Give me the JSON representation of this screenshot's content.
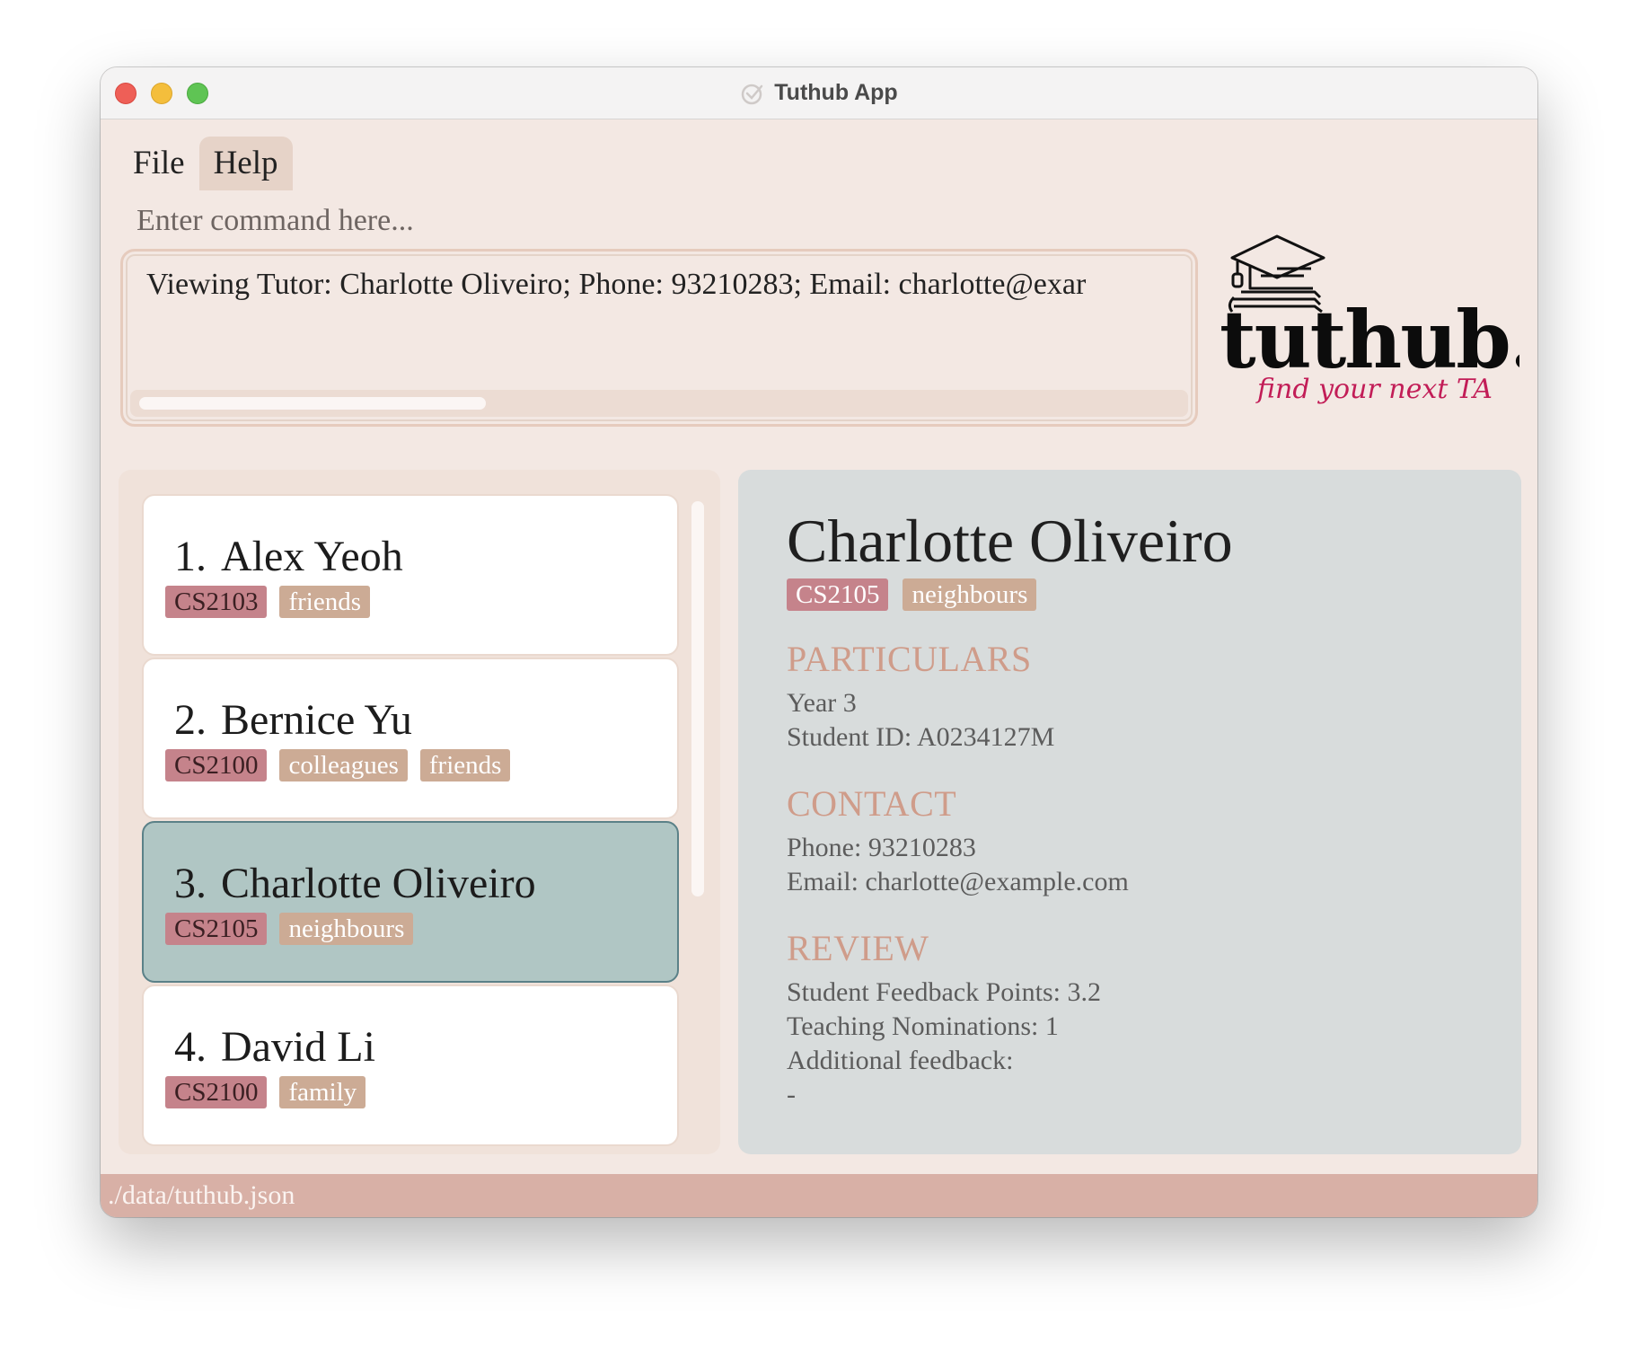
{
  "window": {
    "title": "Tuthub App"
  },
  "menu": {
    "file": "File",
    "help": "Help"
  },
  "command": {
    "placeholder": "Enter command here..."
  },
  "result": {
    "text": "Viewing Tutor: Charlotte Oliveiro; Phone: 93210283; Email: charlotte@exar"
  },
  "logo": {
    "wordmark": "tuthub.",
    "tagline": "find your next TA"
  },
  "tutors": [
    {
      "index": "1.",
      "name": "Alex Yeoh",
      "module": "CS2103",
      "tags": [
        "friends"
      ]
    },
    {
      "index": "2.",
      "name": "Bernice Yu",
      "module": "CS2100",
      "tags": [
        "colleagues",
        "friends"
      ]
    },
    {
      "index": "3.",
      "name": "Charlotte Oliveiro",
      "module": "CS2105",
      "tags": [
        "neighbours"
      ],
      "selected": true
    },
    {
      "index": "4.",
      "name": "David Li",
      "module": "CS2100",
      "tags": [
        "family"
      ]
    }
  ],
  "detail": {
    "name": "Charlotte Oliveiro",
    "module": "CS2105",
    "tag": "neighbours",
    "particulars_heading": "PARTICULARS",
    "year": "Year 3",
    "student_id": "Student ID: A0234127M",
    "contact_heading": "CONTACT",
    "phone": "Phone: 93210283",
    "email": "Email: charlotte@example.com",
    "review_heading": "REVIEW",
    "feedback_points": "Student Feedback Points: 3.2",
    "nominations": "Teaching Nominations: 1",
    "additional_feedback": "Additional feedback:",
    "additional_feedback_value": "-"
  },
  "status": {
    "path": "./data/tuthub.json"
  },
  "colors": {
    "module_tag": "#c5838b",
    "label_tag": "#ccab95",
    "selected_card": "#b0c6c4",
    "section_heading": "#cf9c8a",
    "status_bar": "#d8b0a6"
  }
}
